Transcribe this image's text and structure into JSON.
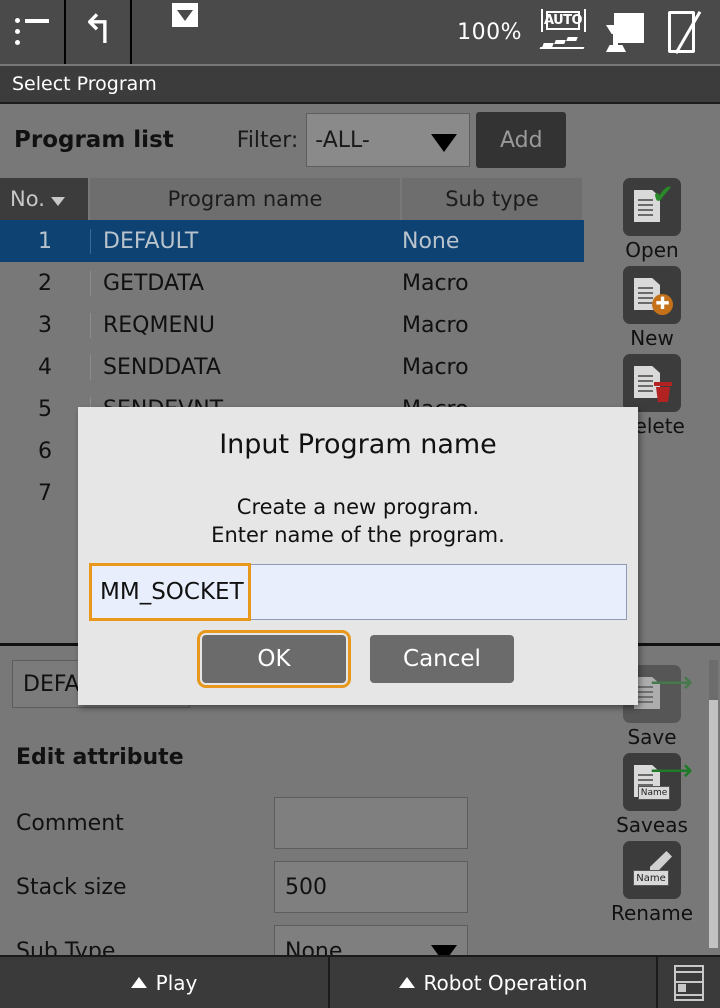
{
  "toolbar": {
    "menu_icon": "hamburger-menu-icon",
    "back_icon": "undo-arrow-icon",
    "dropdown_icon": "caret-down-icon",
    "zoom_level": "100%",
    "auto_icon_label": "AUTO",
    "teach_icon": "teach-pendant-icon",
    "tablet_icon": "tablet-disabled-icon"
  },
  "titlebar": {
    "title": "Select Program"
  },
  "listheader": {
    "title": "Program list",
    "filter_label": "Filter:",
    "filter_value": "-ALL-",
    "add_label": "Add"
  },
  "table": {
    "columns": [
      "No.",
      "Program name",
      "Sub type"
    ],
    "rows": [
      {
        "no": "1",
        "name": "DEFAULT",
        "sub": "None",
        "selected": true
      },
      {
        "no": "2",
        "name": "GETDATA",
        "sub": "Macro",
        "selected": false
      },
      {
        "no": "3",
        "name": "REQMENU",
        "sub": "Macro",
        "selected": false
      },
      {
        "no": "4",
        "name": "SENDDATA",
        "sub": "Macro",
        "selected": false
      },
      {
        "no": "5",
        "name": "SENDEVNT",
        "sub": "Macro",
        "selected": false
      },
      {
        "no": "6",
        "name": "",
        "sub": "",
        "selected": false
      },
      {
        "no": "7",
        "name": "",
        "sub": "",
        "selected": false
      }
    ]
  },
  "sidebar": {
    "items": [
      {
        "label": "Open",
        "icon": "document-check-icon"
      },
      {
        "label": "New",
        "icon": "document-plus-icon"
      },
      {
        "label": "Delete",
        "icon": "document-trash-icon"
      }
    ],
    "items_lower": [
      {
        "label": "Save",
        "icon": "document-save-arrow-icon"
      },
      {
        "label": "Saveas",
        "icon": "document-saveas-name-icon"
      },
      {
        "label": "Rename",
        "icon": "pencil-name-icon"
      }
    ]
  },
  "lower_panel": {
    "program_name": "DEFAULT",
    "section_title": "Edit attribute",
    "attributes": [
      {
        "label": "Comment",
        "value": "",
        "type": "text"
      },
      {
        "label": "Stack size",
        "value": "500",
        "type": "text"
      },
      {
        "label": "Sub Type",
        "value": "None",
        "type": "select"
      }
    ]
  },
  "dialog": {
    "title": "Input Program name",
    "message_line1": "Create a new program.",
    "message_line2": "Enter name of the program.",
    "input_value": "MM_SOCKET",
    "ok_label": "OK",
    "cancel_label": "Cancel"
  },
  "bottombar": {
    "play_label": "Play",
    "robot_label": "Robot Operation",
    "window_icon": "window-layout-icon"
  },
  "colors": {
    "background": "#787878",
    "toolbar": "#4a4a4a",
    "titlebar": "#3c3c3c",
    "selected_row": "#0e4272",
    "accent_focus": "#e8991d",
    "dialog_bg": "#e6e6e6",
    "input_bg": "#e8eefb"
  }
}
